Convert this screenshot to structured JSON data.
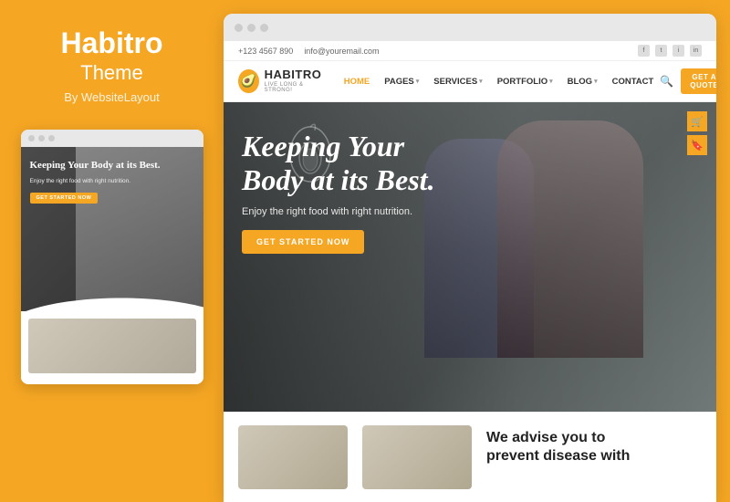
{
  "brand": {
    "name": "Habitro",
    "subtitle": "Theme",
    "by": "By WebsiteLayout"
  },
  "topbar": {
    "phone": "+123 4567 890",
    "email": "info@youremail.com"
  },
  "navbar": {
    "logo_name": "HABITRO",
    "logo_tagline": "LIVE LONG & STRONG!",
    "logo_emoji": "🥑",
    "items": [
      {
        "label": "HOME",
        "active": true,
        "has_arrow": false
      },
      {
        "label": "PAGES",
        "active": false,
        "has_arrow": true
      },
      {
        "label": "SERVICES",
        "active": false,
        "has_arrow": true
      },
      {
        "label": "PORTFOLIO",
        "active": false,
        "has_arrow": true
      },
      {
        "label": "BLOG",
        "active": false,
        "has_arrow": true
      },
      {
        "label": "CONTACT",
        "active": false,
        "has_arrow": false
      }
    ],
    "get_quote_label": "GET A QUOTE"
  },
  "hero": {
    "heading_line1": "Keeping Your",
    "heading_line2": "Body at its Best.",
    "subtext": "Enjoy the right food with right nutrition.",
    "cta_label": "GET STARTED NOW"
  },
  "mini_hero": {
    "heading": "Keeping Your Body at its Best.",
    "subtext": "Enjoy the right food with right nutrition.",
    "cta_label": "GET STARTED NOW"
  },
  "bottom": {
    "heading_line1": "We advise you to",
    "heading_line2": "prevent disease with"
  },
  "colors": {
    "brand_orange": "#F5A623",
    "text_dark": "#222222",
    "text_light": "#ffffff",
    "bg_white": "#ffffff"
  }
}
